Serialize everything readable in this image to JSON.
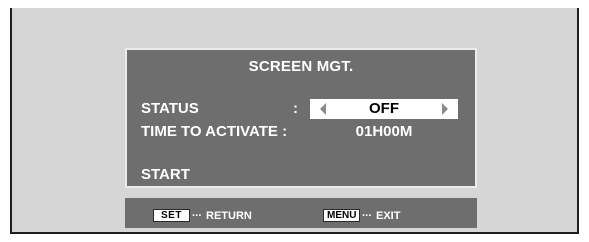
{
  "osd": {
    "title": "SCREEN MGT.",
    "status": {
      "label": "STATUS",
      "separator": ":",
      "value": "OFF"
    },
    "time_to_activate": {
      "label": "TIME TO ACTIVATE :",
      "value": "01H00M"
    },
    "start": {
      "label": "START"
    }
  },
  "hints": {
    "set_key": "SET",
    "set_dots": "···",
    "set_action": "RETURN",
    "menu_key": "MENU",
    "menu_dots": "···",
    "menu_action": "EXIT"
  },
  "colors": {
    "panel": "#6e6e6e",
    "screen": "#d6d6d6",
    "highlight": "#ffffff"
  }
}
